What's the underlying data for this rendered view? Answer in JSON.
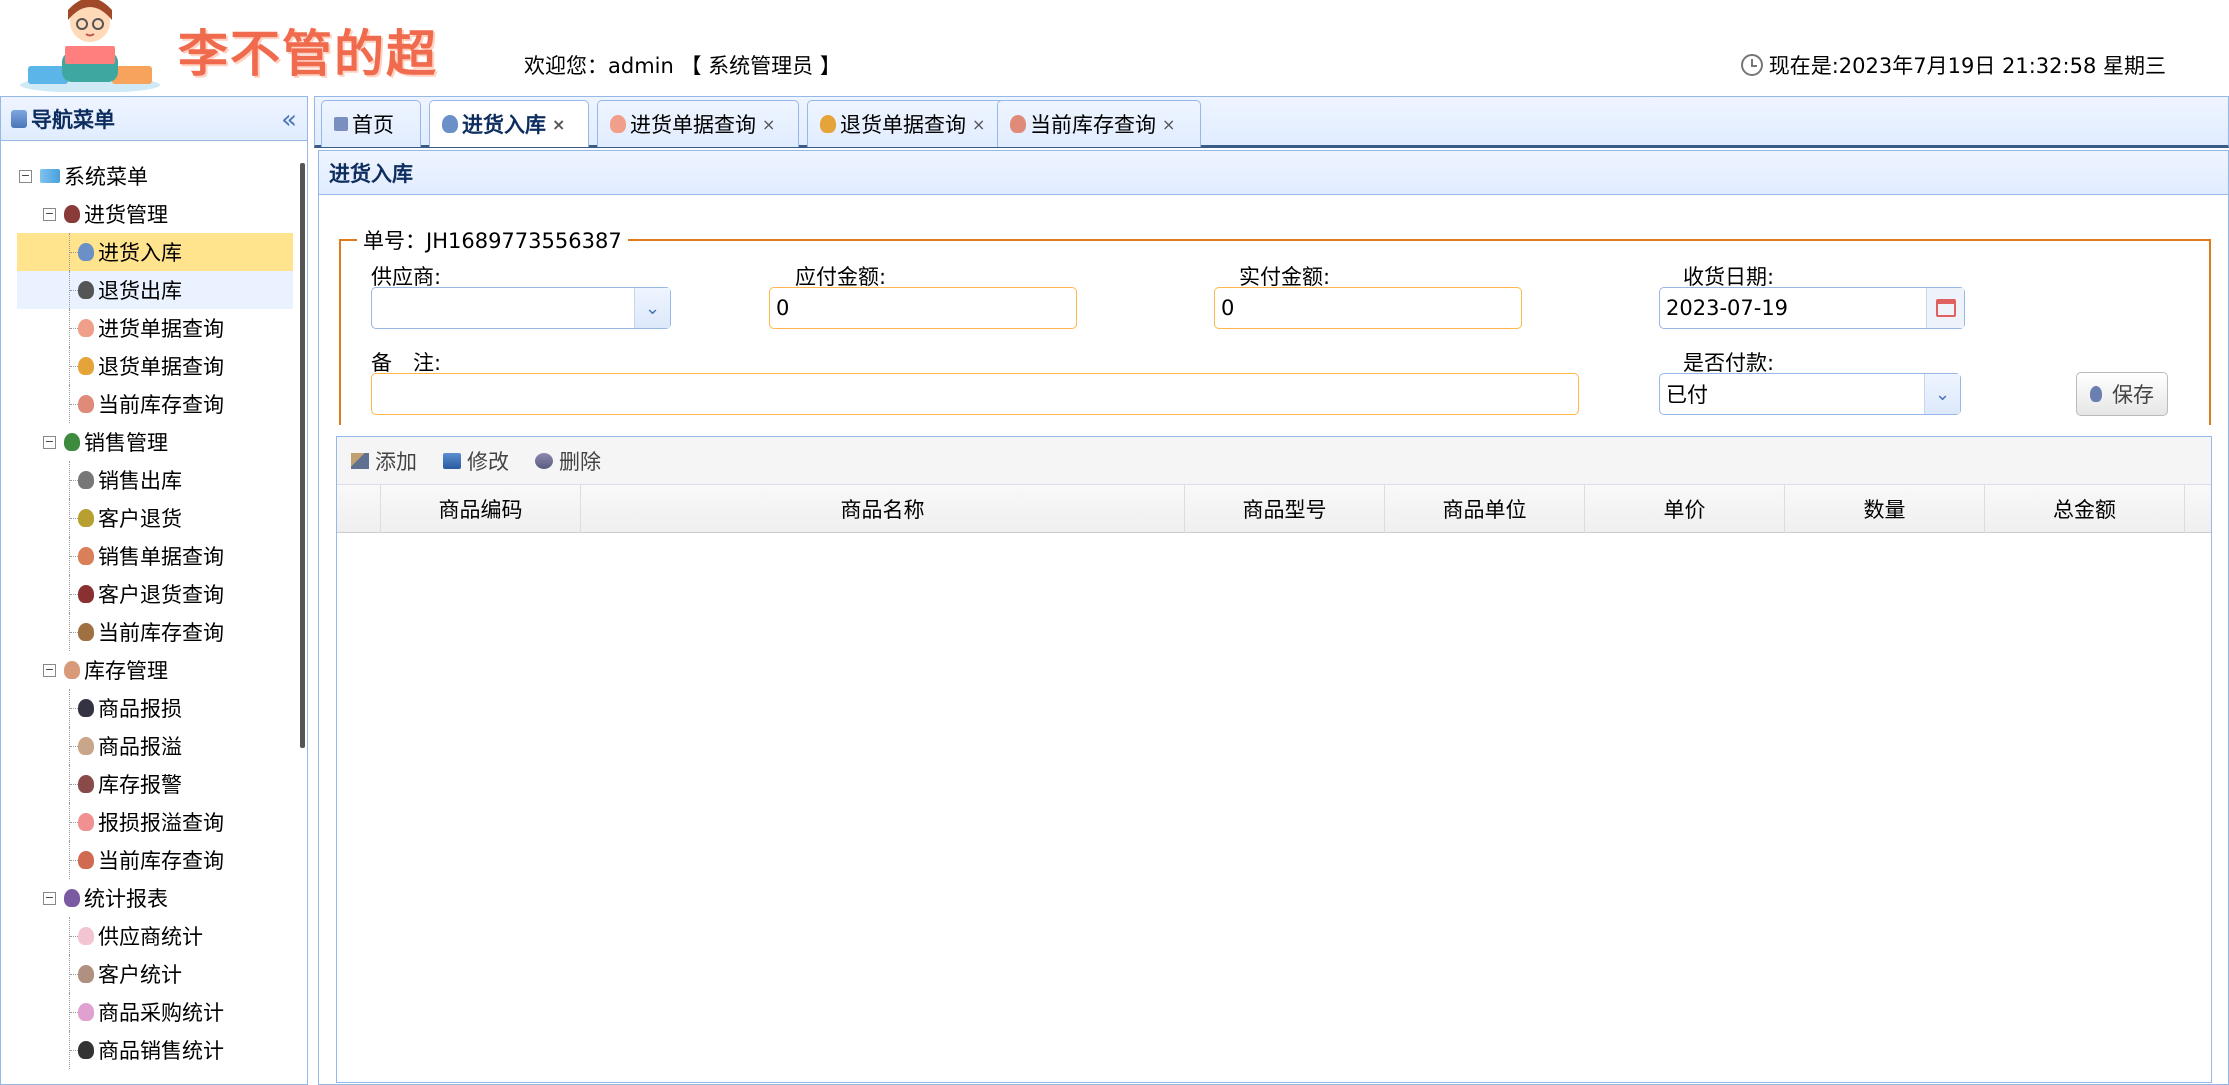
{
  "header": {
    "logo_text": "李不管的超市",
    "welcome": "欢迎您：admin 【 系统管理员 】",
    "clock": "现在是:2023年7月19日 21:32:58 星期三"
  },
  "nav": {
    "title": "导航菜单",
    "collapse": "«",
    "root": "系统菜单",
    "groups": [
      {
        "label": "进货管理",
        "items": [
          "进货入库",
          "退货出库",
          "进货单据查询",
          "退货单据查询",
          "当前库存查询"
        ]
      },
      {
        "label": "销售管理",
        "items": [
          "销售出库",
          "客户退货",
          "销售单据查询",
          "客户退货查询",
          "当前库存查询"
        ]
      },
      {
        "label": "库存管理",
        "items": [
          "商品报损",
          "商品报溢",
          "库存报警",
          "报损报溢查询",
          "当前库存查询"
        ]
      },
      {
        "label": "统计报表",
        "items": [
          "供应商统计",
          "客户统计",
          "商品采购统计",
          "商品销售统计"
        ]
      }
    ]
  },
  "tabs": [
    {
      "label": "首页",
      "closable": false
    },
    {
      "label": "进货入库",
      "closable": true
    },
    {
      "label": "进货单据查询",
      "closable": true
    },
    {
      "label": "退货单据查询",
      "closable": true
    },
    {
      "label": "当前库存查询",
      "closable": true
    }
  ],
  "panel": {
    "title": "进货入库",
    "legend": "单号：JH1689773556387",
    "supplier_label": "供应商:",
    "supplier_value": "",
    "payable_label": "应付金额:",
    "payable_value": "0",
    "paid_label": "实付金额:",
    "paid_value": "0",
    "date_label": "收货日期:",
    "date_value": "2023-07-19",
    "remark_label": "备　注:",
    "remark_value": "",
    "paystatus_label": "是否付款:",
    "paystatus_value": "已付",
    "save_label": "保存"
  },
  "grid": {
    "toolbar": {
      "add": "添加",
      "edit": "修改",
      "delete": "删除"
    },
    "columns": [
      "商品编码",
      "商品名称",
      "商品型号",
      "商品单位",
      "单价",
      "数量",
      "总金额"
    ],
    "rows": []
  },
  "colors": {
    "accent_blue": "#95b8e7",
    "header_grad": "#e0ecff",
    "selected": "#ffe48d",
    "fieldset_border": "#e07b1a",
    "logo_text": "#f06a4e"
  }
}
